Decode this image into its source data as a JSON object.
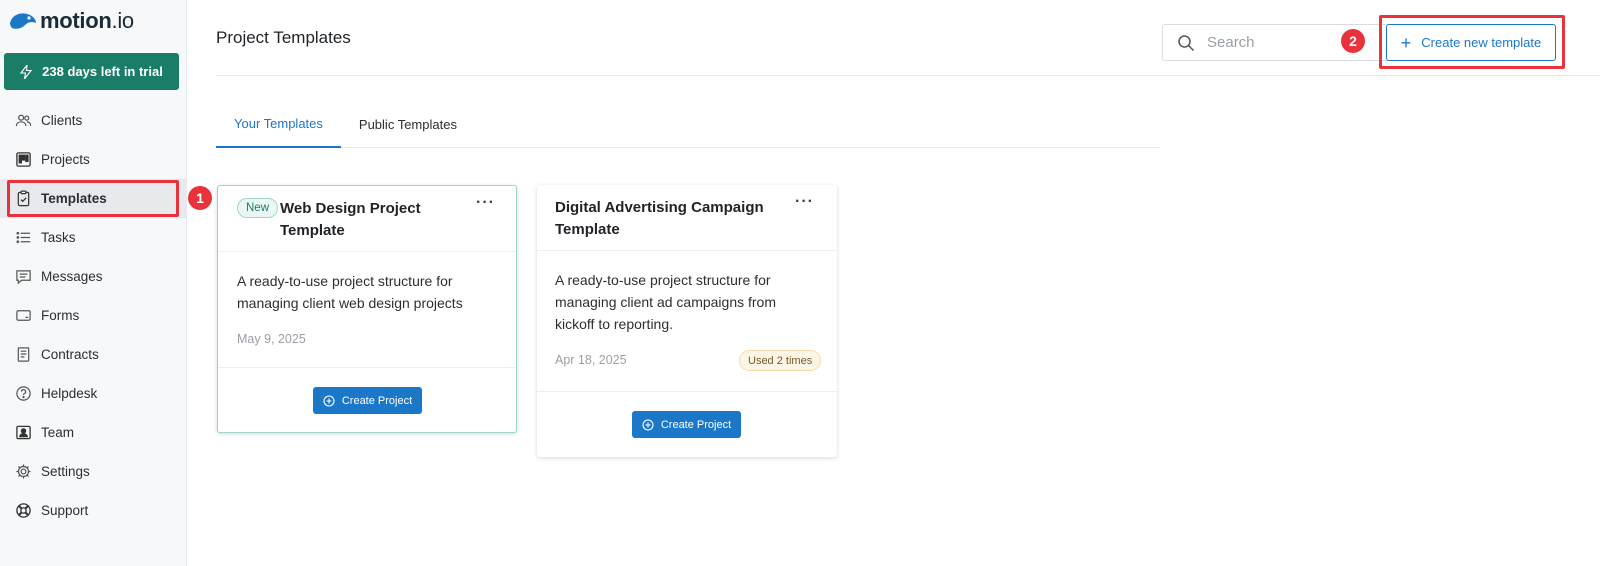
{
  "app": {
    "logo_text": "motion",
    "logo_suffix": ".io"
  },
  "sidebar": {
    "trial_label": "238 days left in trial",
    "items": [
      {
        "label": "Clients",
        "icon": "users-icon"
      },
      {
        "label": "Projects",
        "icon": "kanban-icon"
      },
      {
        "label": "Templates",
        "icon": "clipboard-check-icon"
      },
      {
        "label": "Tasks",
        "icon": "list-icon"
      },
      {
        "label": "Messages",
        "icon": "message-icon"
      },
      {
        "label": "Forms",
        "icon": "form-icon"
      },
      {
        "label": "Contracts",
        "icon": "document-icon"
      },
      {
        "label": "Helpdesk",
        "icon": "question-icon"
      },
      {
        "label": "Team",
        "icon": "team-icon"
      },
      {
        "label": "Settings",
        "icon": "gear-icon"
      },
      {
        "label": "Support",
        "icon": "lifebuoy-icon"
      }
    ],
    "active_item": "Templates"
  },
  "header": {
    "title": "Project Templates",
    "search_placeholder": "Search",
    "create_label": "Create new template"
  },
  "tabs": [
    {
      "label": "Your Templates",
      "active": true
    },
    {
      "label": "Public Templates",
      "active": false
    }
  ],
  "annotations": {
    "step1": "1",
    "step2": "2",
    "highlight_color": "#e8323c"
  },
  "cards": [
    {
      "badge": "New",
      "title": "Web Design Project Template",
      "description": "A ready-to-use project structure for managing client web design projects",
      "date": "May 9, 2025",
      "button_label": "Create Project"
    },
    {
      "title": "Digital Advertising Campaign Template",
      "description": "A ready-to-use project structure for managing client ad campaigns from kickoff to reporting.",
      "date": "Apr 18, 2025",
      "usage": "Used 2 times",
      "button_label": "Create Project"
    }
  ],
  "colors": {
    "brand_green": "#1a7d67",
    "primary_blue": "#1b78c8"
  }
}
